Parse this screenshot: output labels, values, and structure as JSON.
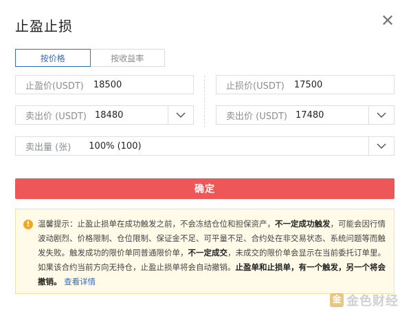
{
  "dialog": {
    "title": "止盈止损",
    "close_label": "✕"
  },
  "tabs": [
    {
      "label": "按价格",
      "active": true
    },
    {
      "label": "按收益率",
      "active": false
    }
  ],
  "take_profit": {
    "price_label": "止盈价(USDT)",
    "price_value": "18500",
    "sell_label": "卖出价 (USDT)",
    "sell_value": "18480"
  },
  "stop_loss": {
    "price_label": "止损价(USDT)",
    "price_value": "17500",
    "sell_label": "卖出价 (USDT)",
    "sell_value": "17480"
  },
  "quantity": {
    "label": "卖出量 (张)",
    "value": "100% (100)"
  },
  "confirm_label": "确定",
  "notice": {
    "part1": "温馨提示：止盈止损单在成功触发之前，不会冻结仓位和担保资产，",
    "bold1": "不一定成功触发",
    "part2": "，可能会因行情波动剧烈、价格限制、仓位限制、保证金不足、可平量不足、合约处在非交易状态、系统问题等而触发失败。触发成功的限价单同普通限价单，",
    "bold2": "不一定成交",
    "part3": "，未成交的限价单会显示在当前委托订单里。 如果该合约当前方向无持仓，止盈止损单将会自动撤销。",
    "bold3": "止盈单和止损单，有一个触发，另一个将会撤销。",
    "link": "查看详情"
  },
  "watermark": {
    "logo": "金",
    "text": "金色财经"
  },
  "colors": {
    "accent": "#2f6cc4",
    "confirm": "#ee5757",
    "warning": "#f0a821"
  }
}
